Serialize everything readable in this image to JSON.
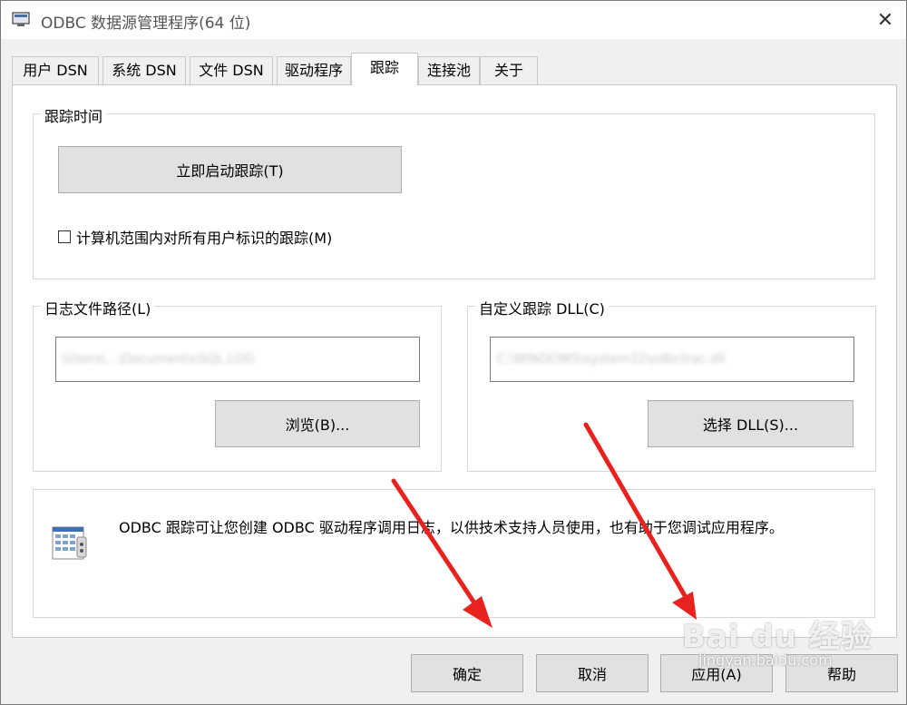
{
  "window": {
    "title": "ODBC 数据源管理程序(64 位)",
    "close_glyph": "✕"
  },
  "tabs": [
    {
      "label": "用户 DSN"
    },
    {
      "label": "系统 DSN"
    },
    {
      "label": "文件 DSN"
    },
    {
      "label": "驱动程序"
    },
    {
      "label": "跟踪",
      "active": true
    },
    {
      "label": "连接池"
    },
    {
      "label": "关于"
    }
  ],
  "trace_time": {
    "group_label": "跟踪时间",
    "start_button": "立即启动跟踪(T)",
    "machine_wide_checkbox": "计算机范围内对所有用户标识的跟踪(M)",
    "machine_wide_checked": false
  },
  "log_file": {
    "group_label": "日志文件路径(L)",
    "path_value": "\\Users\\...\\Documents\\SQL.LOG",
    "browse_button": "浏览(B)..."
  },
  "custom_dll": {
    "group_label": "自定义跟踪 DLL(C)",
    "dll_value": "C:\\WINDOWS\\system32\\odbctrac.dll",
    "select_button": "选择 DLL(S)..."
  },
  "info": {
    "text": "ODBC 跟踪可让您创建 ODBC 驱动程序调用日志，以供技术支持人员使用，也有助于您调试应用程序。",
    "icon": "log-document-icon"
  },
  "footer": {
    "ok": "确定",
    "cancel": "取消",
    "apply": "应用(A)",
    "help": "帮助"
  },
  "watermark": {
    "brand": "Bai du 经验",
    "url": "jingyan.baidu.com"
  },
  "colors": {
    "annotation_arrow": "#e8231f",
    "button_face": "#e1e1e1"
  }
}
